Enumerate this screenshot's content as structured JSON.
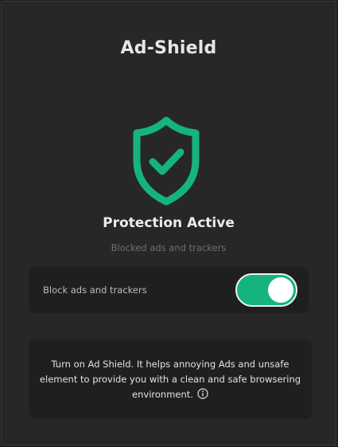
{
  "header": {
    "title": "Ad-Shield"
  },
  "status": {
    "icon": "shield-check-icon",
    "title": "Protection Active",
    "subtitle": "Blocked ads and trackers"
  },
  "toggle": {
    "label": "Block ads and trackers",
    "enabled": true
  },
  "info": {
    "text": "Turn on Ad Shield. It helps annoying Ads and unsafe element to provide you with a clean and safe browsering environment.",
    "icon": "info-icon"
  },
  "colors": {
    "background": "#272727",
    "accent": "#15b47f",
    "panel": "#1f1f1f"
  }
}
